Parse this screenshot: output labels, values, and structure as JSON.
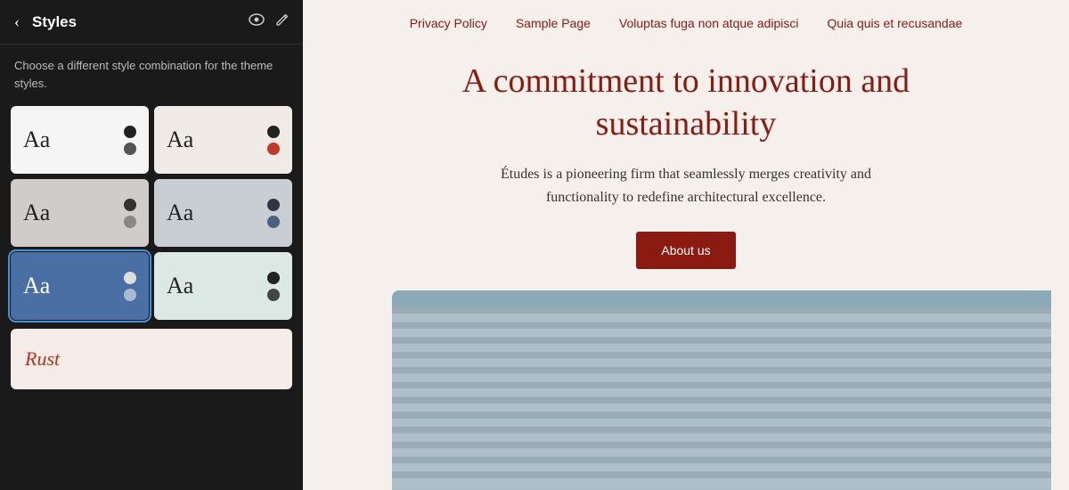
{
  "panel": {
    "back_label": "‹",
    "title": "Styles",
    "eye_icon": "👁",
    "edit_icon": "✏",
    "description": "Choose a different style combination for the theme styles."
  },
  "style_cards": [
    {
      "id": "card-1",
      "variant": "card-white",
      "label": "Aa",
      "selected": false
    },
    {
      "id": "card-2",
      "variant": "card-pink",
      "label": "Aa",
      "selected": false
    },
    {
      "id": "card-3",
      "variant": "card-gray",
      "label": "Aa",
      "selected": false
    },
    {
      "id": "card-4",
      "variant": "card-blue-gray",
      "label": "Aa",
      "selected": false
    },
    {
      "id": "card-5",
      "variant": "card-blue",
      "label": "Aa",
      "selected": true
    },
    {
      "id": "card-6",
      "variant": "card-light-teal",
      "label": "Aa",
      "selected": false
    }
  ],
  "rust_card": {
    "label": "Rust"
  },
  "nav": {
    "links": [
      "Privacy Policy",
      "Sample Page",
      "Voluptas fuga non atque adipisci",
      "Quia quis et recusandae"
    ]
  },
  "hero": {
    "title": "A commitment to innovation and sustainability",
    "subtitle": "Études is a pioneering firm that seamlessly merges creativity and functionality to redefine architectural excellence.",
    "cta_label": "About us"
  }
}
